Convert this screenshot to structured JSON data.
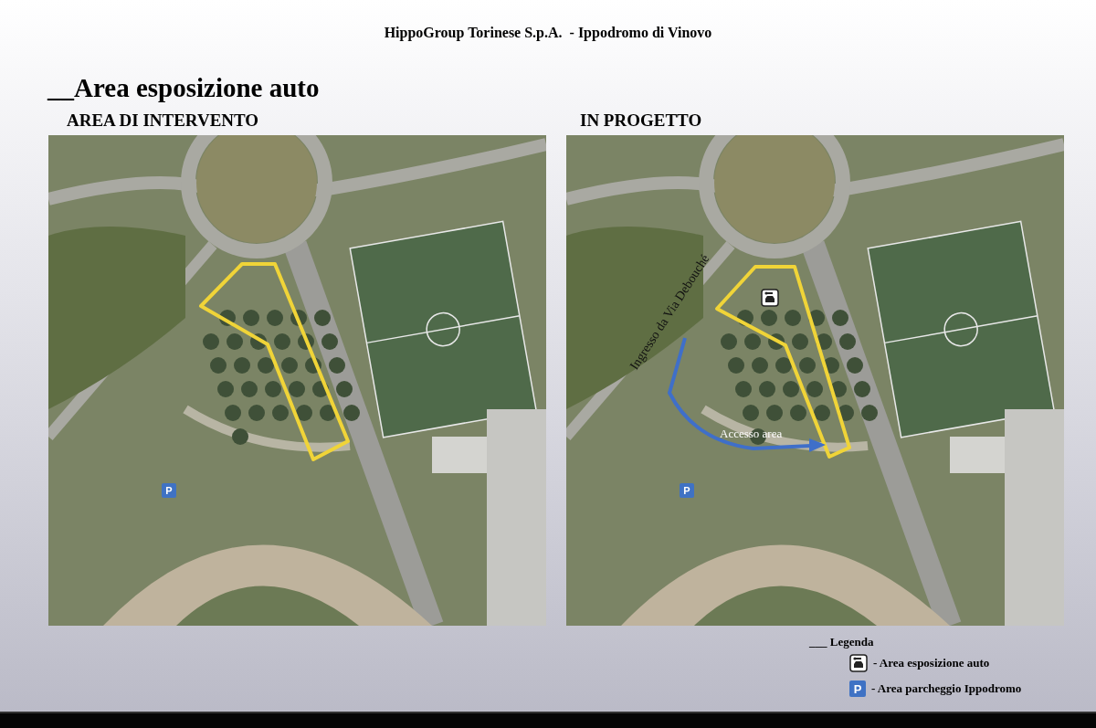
{
  "header": {
    "title": "HippoGroup Torinese S.p.A.  - Ippodromo di Vinovo"
  },
  "section_title": "__Area esposizione auto",
  "panels": [
    {
      "heading": "AREA DI INTERVENTO",
      "features": [
        {
          "kind": "outline-existing"
        },
        {
          "kind": "parking",
          "text": "P"
        }
      ]
    },
    {
      "heading": "IN PROGETTO",
      "features": [
        {
          "kind": "outline-project"
        },
        {
          "kind": "showroom"
        },
        {
          "kind": "road-label",
          "text": "Ingresso da Via Debouché"
        },
        {
          "kind": "route",
          "text": "Accesso area"
        },
        {
          "kind": "parking",
          "text": "P"
        }
      ]
    }
  ],
  "legend": {
    "title": "___ Legenda",
    "items": [
      {
        "kind": "showroom",
        "text": "- Area esposizione auto"
      },
      {
        "kind": "parking",
        "symbol": "P",
        "text": "- Area parcheggio Ippodromo"
      }
    ]
  }
}
